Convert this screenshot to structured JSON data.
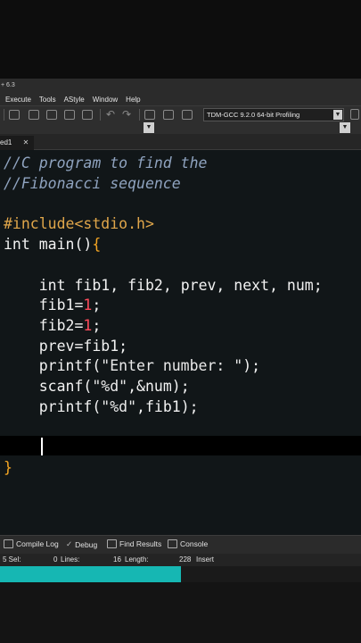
{
  "window": {
    "title": "+ 6.3"
  },
  "menu": [
    "Execute",
    "Tools",
    "AStyle",
    "Window",
    "Help"
  ],
  "toolbar": {
    "compiler": "TDM-GCC 9.2.0 64-bit Profiling",
    "undo_icon": "undo-icon",
    "redo_icon": "redo-icon"
  },
  "tab": {
    "label": "ed1",
    "close": "✕"
  },
  "editor": {
    "lines": [
      "//C program to find the",
      "//Fibonacci sequence",
      "",
      "#include<stdio.h>",
      "int main(){",
      "",
      "    int fib1, fib2, prev, next, num;",
      "    fib1=1;",
      "    fib2=1;",
      "    prev=fib1;",
      "    printf(\"Enter number: \");",
      "    scanf(\"%d\",&num);",
      "    printf(\"%d\",fib1);",
      "",
      "",
      "}"
    ]
  },
  "bottom_panel": {
    "tabs": [
      "Compile Log",
      "Debug",
      "Find Results",
      "Console"
    ]
  },
  "statusbar": {
    "sel_label": "5 Sel:",
    "sel_value": "0",
    "lines_label": "Lines:",
    "lines_value": "16",
    "length_label": "Length:",
    "length_value": "228",
    "mode": "Insert"
  },
  "progress": {
    "fraction": 0.5,
    "color": "#16b7b3"
  },
  "colors": {
    "editor_bg": "#111618",
    "comment": "#8fa3bf",
    "preprocessor": "#e0a64a",
    "number": "#ff4b5c",
    "brace": "#f5a623"
  }
}
